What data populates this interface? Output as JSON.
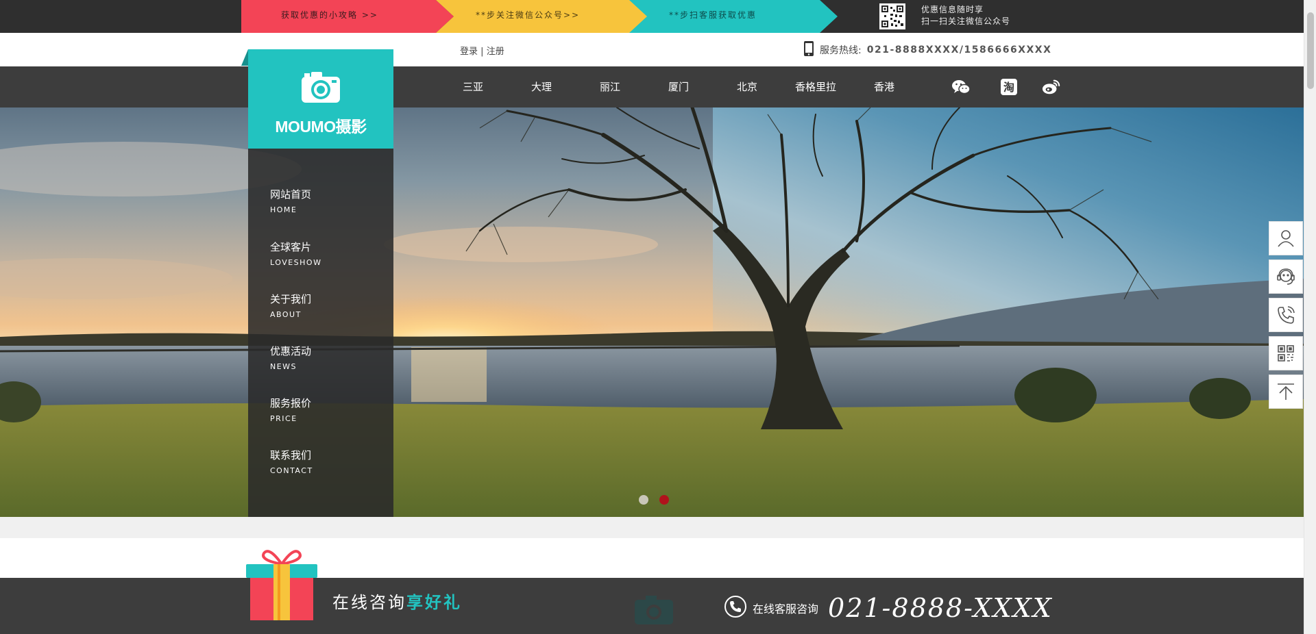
{
  "promo": {
    "seg1": "获取优惠的小攻略 >>",
    "seg2": "**步关注微信公众号>>",
    "seg3": "**步扫客服获取优惠",
    "qr_line1": "优惠信息随时享",
    "qr_line2": "扫一扫关注微信公众号"
  },
  "topbar": {
    "login": "登录",
    "separator": "|",
    "register": "注册",
    "hotline_label": "服务热线:",
    "hotline_number": "021-8888XXXX/1586666XXXX"
  },
  "logo": {
    "text": "MOUMO摄影"
  },
  "nav": [
    "三亚",
    "大理",
    "丽江",
    "厦门",
    "北京",
    "香格里拉",
    "香港"
  ],
  "social": [
    {
      "name": "wechat-icon"
    },
    {
      "name": "taobao-icon",
      "glyph": "淘"
    },
    {
      "name": "weibo-icon"
    }
  ],
  "menu": [
    {
      "cn": "网站首页",
      "en": "HOME"
    },
    {
      "cn": "全球客片",
      "en": "LOVESHOW"
    },
    {
      "cn": "关于我们",
      "en": "ABOUT"
    },
    {
      "cn": "优惠活动",
      "en": "NEWS"
    },
    {
      "cn": "服务报价",
      "en": "PRICE"
    },
    {
      "cn": "联系我们",
      "en": "CONTACT"
    }
  ],
  "slider": {
    "total": 2,
    "active": 2
  },
  "float_bar": [
    "user-icon",
    "customer-service-icon",
    "phone-icon",
    "qrcode-icon",
    "back-to-top-icon"
  ],
  "footer": {
    "consult_text": "在线咨询",
    "consult_highlight": "享好礼",
    "online_label": "在线客服咨询",
    "online_number": "021-8888-XXXX"
  },
  "colors": {
    "accent": "#22c3c0",
    "promo_red": "#f34456",
    "promo_yellow": "#f7c43c",
    "dark": "#3d3d3d"
  }
}
